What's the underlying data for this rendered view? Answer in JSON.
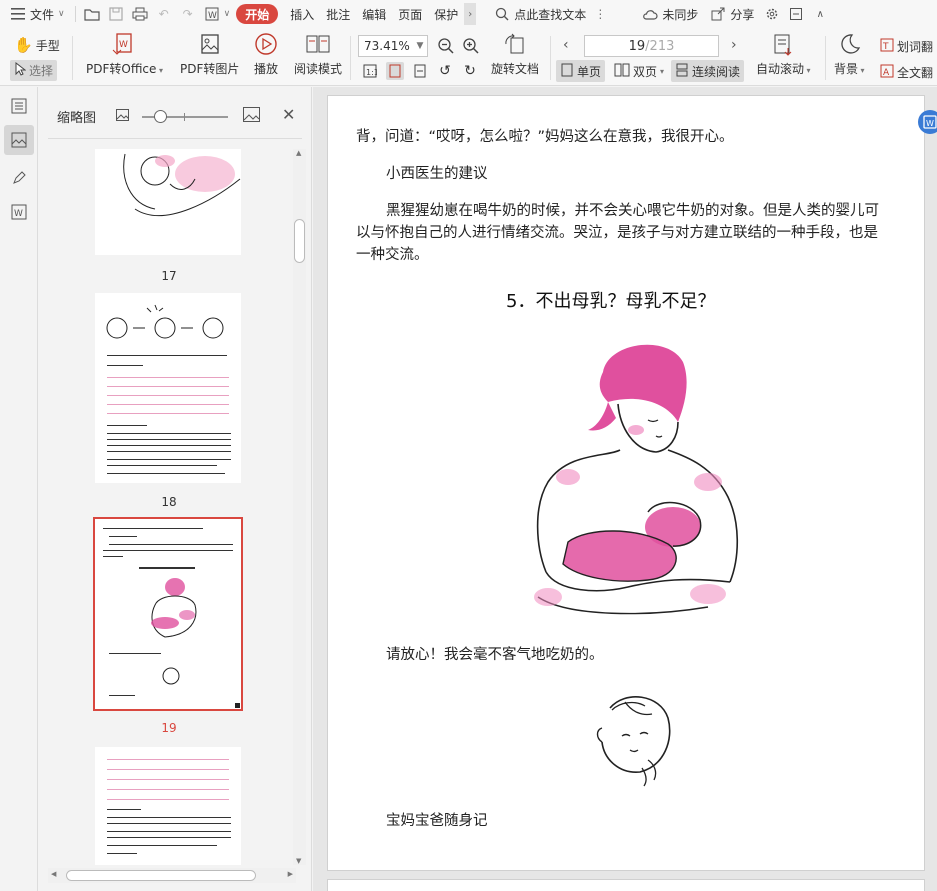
{
  "menu": {
    "file": "文件",
    "tabs": [
      "开始",
      "插入",
      "批注",
      "编辑",
      "页面",
      "保护"
    ],
    "search": "点此查找文本",
    "sync": "未同步",
    "share": "分享"
  },
  "toolbar": {
    "hand": "手型",
    "select": "选择",
    "pdf_to_office": "PDF转Office",
    "pdf_to_image": "PDF转图片",
    "play": "播放",
    "read_mode": "阅读模式",
    "zoom": "73.41%",
    "page_current": "19",
    "page_total": "/213",
    "rotate": "旋转文档",
    "single": "单页",
    "double": "双页",
    "continuous": "连续阅读",
    "auto_scroll": "自动滚动",
    "background": "背景",
    "word_translate": "划词翻",
    "full_translate": "全文翻"
  },
  "thumbs": {
    "title": "缩略图",
    "pages": [
      "17",
      "18",
      "19"
    ],
    "selected": "19"
  },
  "doc": {
    "p1": "背，问道：“哎呀，怎么啦？”妈妈这么在意我，我很开心。",
    "p2": "小西医生的建议",
    "p3a": "黑猩猩幼崽在喝牛奶的时候，并不会关心喂它牛奶的对象。但是人类的婴儿可",
    "p3b": "以与怀抱自己的人进行情绪交流。哭泣，是孩子与对方建立联结的一种手段，也是",
    "p3c": "一种交流。",
    "heading": "5．不出母乳？母乳不足？",
    "p4": "请放心！我会毫不客气地吃奶的。",
    "p5": "宝妈宝爸随身记"
  },
  "colors": {
    "accent": "#d9473f",
    "pink": "#e0509e"
  }
}
